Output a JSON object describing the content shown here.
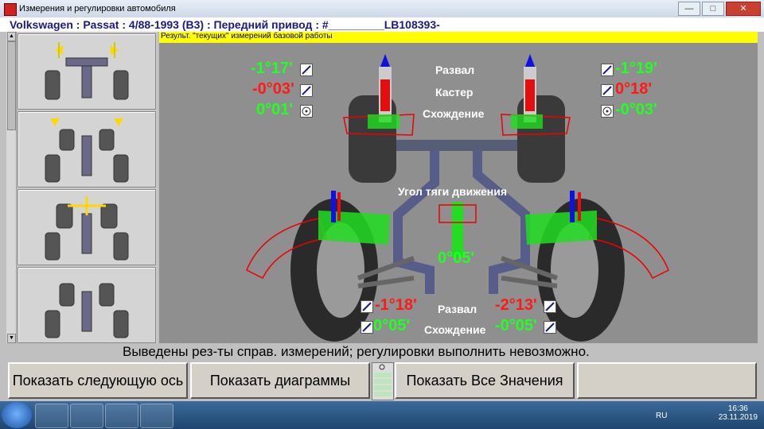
{
  "window": {
    "title": "Измерения и регулировки автомобиля",
    "minimize": "—",
    "maximize": "□",
    "close": "✕"
  },
  "vehicle": {
    "line": "Volkswagen : Passat : 4/88-1993 (B3) : Передний привод : #_________LB108393-"
  },
  "result_header": "Результ. \"текущих\" измерений базовой работы",
  "front": {
    "left": {
      "camber": "-1°17'",
      "caster": "-0°03'",
      "toe": "0°01'"
    },
    "right": {
      "camber": "-1°19'",
      "caster": "0°18'",
      "toe": "-0°03'"
    },
    "labels": {
      "camber": "Развал",
      "caster": "Кастер",
      "toe": "Схождение"
    }
  },
  "thrust": {
    "label": "Угол тяги движения",
    "value": "0°05'"
  },
  "rear": {
    "left": {
      "camber": "-1°18'",
      "toe": "0°05'"
    },
    "right": {
      "camber": "-2°13'",
      "toe": "-0°05'"
    },
    "labels": {
      "camber": "Развал",
      "toe": "Схождение"
    }
  },
  "status": "Выведены рез-ты справ. измерений; регулировки выполнить невозможно.",
  "buttons": {
    "next_axle": "Показать следующую ось",
    "diagrams": "Показать диаграммы",
    "all_values": "Показать Все Значения",
    "empty": ""
  },
  "taskbar": {
    "lang": "RU",
    "time": "16:36",
    "date": "23.11.2019"
  },
  "colors": {
    "bad": "#ff1a1a",
    "good": "#22ff22",
    "header": "#ffff00",
    "title_text": "#1a1a80"
  }
}
